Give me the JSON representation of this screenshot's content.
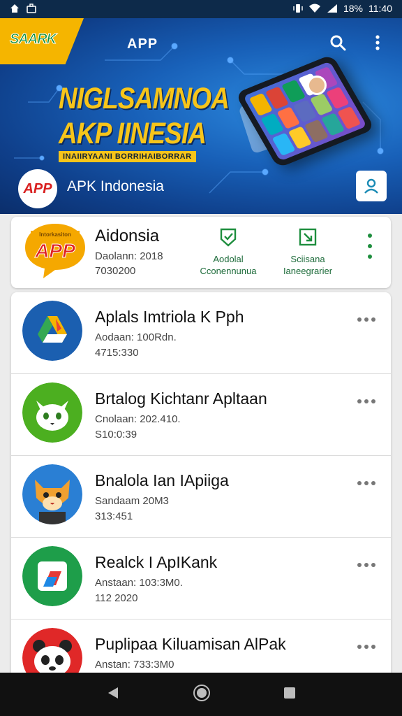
{
  "status_bar": {
    "time": "11:40",
    "battery": "18%"
  },
  "header": {
    "logo_text": "SAARK",
    "title": "APP",
    "headline_line1": "NIGLSAMNOA",
    "headline_line2": "AKP IINESIA",
    "subline": "INAIIRYAANI BORRIHAIBORRAR",
    "brand_badge": "APP",
    "brand_name": "APK Indonesia"
  },
  "featured": {
    "icon_badge": "APP",
    "icon_caption": "Intorkasiton",
    "name": "Aidonsia",
    "meta_line1": "Daolann: 2018",
    "meta_line2": "7030200",
    "action1_line1": "Aodolal",
    "action1_line2": "Cconennunua",
    "action2_line1": "Sciisana",
    "action2_line2": "Ianeegrarier"
  },
  "apps": [
    {
      "name": "Aplals Imtriola K Pph",
      "meta_line1": "Aodaan: 100Rdn.",
      "meta_line2": "4715:330",
      "icon": "drive-style-icon"
    },
    {
      "name": "Brtalog Kichtanr Apltaan",
      "meta_line1": "Cnolaan: 202.410.",
      "meta_line2": "S10:0:39",
      "icon": "cat-face-icon"
    },
    {
      "name": "Bnalola Ian IApiiga",
      "meta_line1": "Sandaam 20M3",
      "meta_line2": "313:451",
      "icon": "fox-face-icon"
    },
    {
      "name": "Realck I ApIKank",
      "meta_line1": "Anstaan: 103:3M0.",
      "meta_line2": "112 2020",
      "icon": "folded-arrow-icon"
    },
    {
      "name": "Puplipaa Kiluamisan AlPak",
      "meta_line1": "Anstan: 733:3M0",
      "meta_line2": "",
      "icon": "panda-face-icon"
    }
  ],
  "colors": {
    "accent_green": "#1e8e3e",
    "banner_blue": "#1860b8",
    "headline_yellow": "#f7c51a"
  }
}
